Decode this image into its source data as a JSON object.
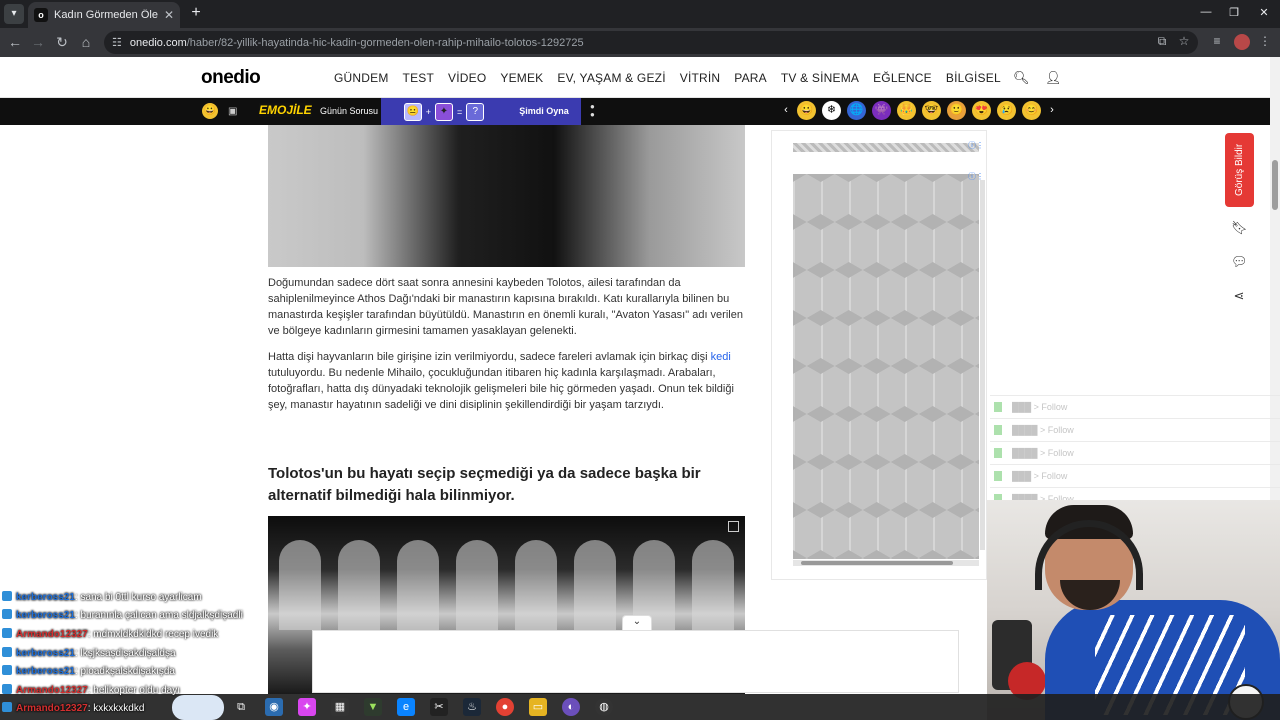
{
  "browser": {
    "tab_title": "Kadın Görmeden Ölen Rahip: M",
    "tab_favicon": "o",
    "url_domain": "onedio.com",
    "url_path": "/haber/82-yillik-hayatinda-hic-kadin-gormeden-olen-rahip-mihailo-tolotos-1292725"
  },
  "site": {
    "logo": "onedio",
    "menu": [
      "GÜNDEM",
      "TEST",
      "VİDEO",
      "YEMEK",
      "EV, YAŞAM & GEZİ",
      "VİTRİN",
      "PARA",
      "TV & SİNEMA",
      "EĞLENCE",
      "BİLGİSEL"
    ]
  },
  "strip": {
    "emojile": "EMOJİLE",
    "gunun_sorusu": "Günün Sorusu",
    "puzzle_q": "?",
    "puzzle_plus": "+",
    "puzzle_eq": "=",
    "simdi_oyna": "Şimdi Oyna",
    "emojis": [
      "😀",
      "❄",
      "🌐",
      "👾",
      "👑",
      "🤓",
      "🙂",
      "😍",
      "😢",
      "😊"
    ]
  },
  "article": {
    "p1": "Doğumundan sadece dört saat sonra annesini kaybeden Tolotos, ailesi tarafından da sahiplenilmeyince Athos Dağı'ndaki bir manastırın kapısına bırakıldı. Katı kurallarıyla bilinen bu manastırda keşişler tarafından büyütüldü. Manastırın en önemli kuralı, \"Avaton Yasası\" adı verilen ve bölgeye kadınların girmesini tamamen yasaklayan gelenekti.",
    "p2_a": "Hatta dişi hayvanların bile girişine izin verilmiyordu, sadece fareleri avlamak için birkaç dişi ",
    "p2_link": "kedi",
    "p2_b": " tutuluyordu. Bu nedenle Mihailo, çocukluğundan itibaren hiç kadınla karşılaşmadı. Arabaları, fotoğrafları, hatta dış dünyadaki teknolojik gelişmeleri bile hiç görmeden yaşadı. Onun tek bildiği şey, manastır hayatının sadeliği ve dini disiplinin şekillendirdiği bir yaşam tarzıydı.",
    "heading": "Tolotos'un bu hayatı seçip seçmediği ya da sadece başka bir alternatif bilmediği hala bilinmiyor."
  },
  "side": {
    "feedback": "Görüş Bildir"
  },
  "follows": [
    "███ > Follow",
    "████ > Follow",
    "████ > Follow",
    "███ > Follow",
    "████ > Follow"
  ],
  "chat": [
    {
      "user": "kerbeross21",
      "msg": ": sana bi 0ttl kurso ayarlicam",
      "color": "u1"
    },
    {
      "user": "kerbeross21",
      "msg": ": buranınla çalıcan ama sldjalkşdişadli",
      "color": "u1"
    },
    {
      "user": "Armando12327",
      "msg": ": mdmxldkdkldkd recep ivedik",
      "color": "u2"
    },
    {
      "user": "kerbeross21",
      "msg": ": lkşjksaşdişakdişaldşa",
      "color": "u1"
    },
    {
      "user": "kerbeross21",
      "msg": ": pioadkşalskdişakışda",
      "color": "u1"
    },
    {
      "user": "Armando12327",
      "msg": ": helikopter oldu dayı",
      "color": "u2"
    },
    {
      "user": "Armando12327",
      "msg": ": kxkxkxkdkd",
      "color": "u2"
    }
  ]
}
